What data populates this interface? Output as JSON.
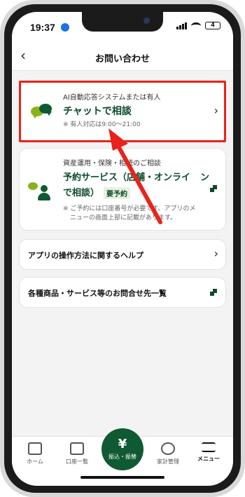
{
  "status": {
    "time": "19:37",
    "battery": "4"
  },
  "header": {
    "back_label": "‹",
    "title": "お問い合わせ"
  },
  "chat_card": {
    "subtitle": "AI自動応答システムまたは有人",
    "title": "チャットで相談",
    "note": "※ 有人対応は9:00〜21:00"
  },
  "reserve_card": {
    "subtitle": "資産運用・保険・相続のご相談",
    "title_line1": "予約サービス（店舗・オンライ",
    "title_line2": "ン",
    "title_line3": "で相談）",
    "tag": "要予約",
    "note_line1": "※ ご予約には口座番号が必要です。アプリのメ",
    "note_line2": "ニューの画面上部に記載があります。"
  },
  "help_row": {
    "label": "アプリの操作方法に関するヘルプ"
  },
  "contact_row": {
    "label": "各種商品・サービス等のお問合せ先一覧"
  },
  "tabbar": {
    "home": "ホーム",
    "accounts": "口座一覧",
    "transfer": "振込・振替",
    "budget": "家計管理",
    "menu": "メニュー"
  },
  "colors": {
    "brand_green": "#0f5a32",
    "accent_lime": "#8ab21b",
    "highlight_red": "#e8231b"
  }
}
